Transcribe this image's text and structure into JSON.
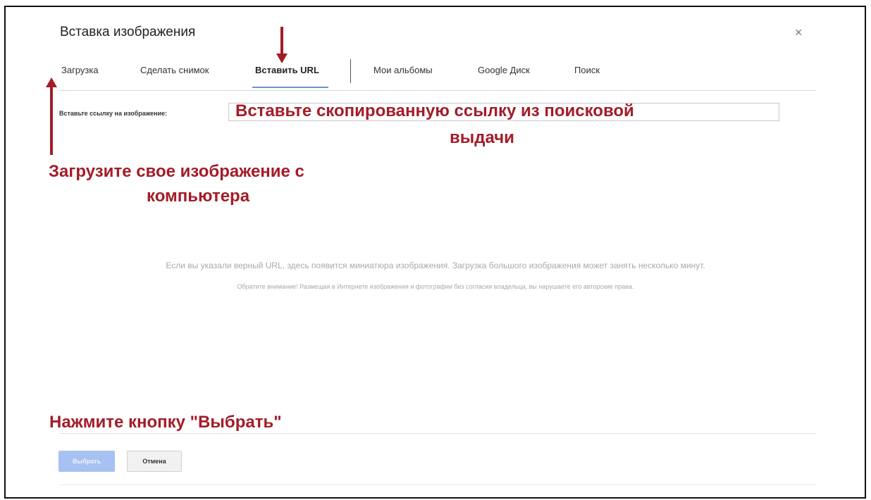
{
  "dialog": {
    "title": "Вставка изображения",
    "close_glyph": "×"
  },
  "tabs": [
    {
      "label": "Загрузка",
      "active": false
    },
    {
      "label": "Сделать снимок",
      "active": false
    },
    {
      "label": "Вставить URL",
      "active": true
    },
    {
      "label": "Мои альбомы",
      "active": false
    },
    {
      "label": "Google Диск",
      "active": false
    },
    {
      "label": "Поиск",
      "active": false
    }
  ],
  "url_field": {
    "label": "Вставьте ссылку на изображение:",
    "value": ""
  },
  "annotations": {
    "url_line1": "Вставьте скопированную ссылку из поисковой",
    "url_line2": "выдачи",
    "upload_line1": "Загрузите свое изображение с",
    "upload_line2": "компьютера",
    "select_hint": "Нажмите кнопку \"Выбрать\""
  },
  "hints": {
    "line1": "Если вы указали верный URL, здесь появится миниатюра изображения. Загрузка большого изображения может занять несколько минут.",
    "line2": "Обратите внимание! Размещая в Интернете изображения и фотографии без согласия владельца, вы нарушаете его авторские права."
  },
  "buttons": {
    "select": "Выбрать",
    "cancel": "Отмена"
  },
  "colors": {
    "annotation": "#a31c28",
    "active_tab_underline": "#6f93cf",
    "select_button": "#a7c1f3"
  },
  "icons": {
    "close": "close-icon",
    "down_arrow": "arrow-down-icon",
    "up_arrow": "arrow-up-icon"
  }
}
